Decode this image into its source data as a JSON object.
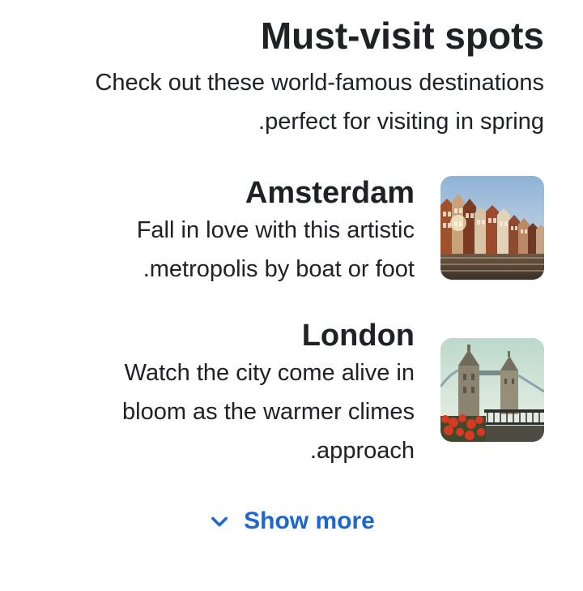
{
  "section": {
    "title": "Must-visit spots",
    "intro_lines": [
      "Check out these world-famous destinations",
      ".perfect for visiting in spring"
    ]
  },
  "spots": [
    {
      "title": "Amsterdam",
      "desc_lines": [
        "Fall in love with this artistic",
        ".metropolis by boat or foot"
      ]
    },
    {
      "title": "London",
      "desc_lines": [
        "Watch the city come alive in",
        "bloom as the warmer climes",
        ".approach"
      ]
    }
  ],
  "show_more": {
    "label": "Show more",
    "icon": "chevron-down-icon"
  },
  "colors": {
    "link": "#1a66d2",
    "text": "#202124"
  }
}
